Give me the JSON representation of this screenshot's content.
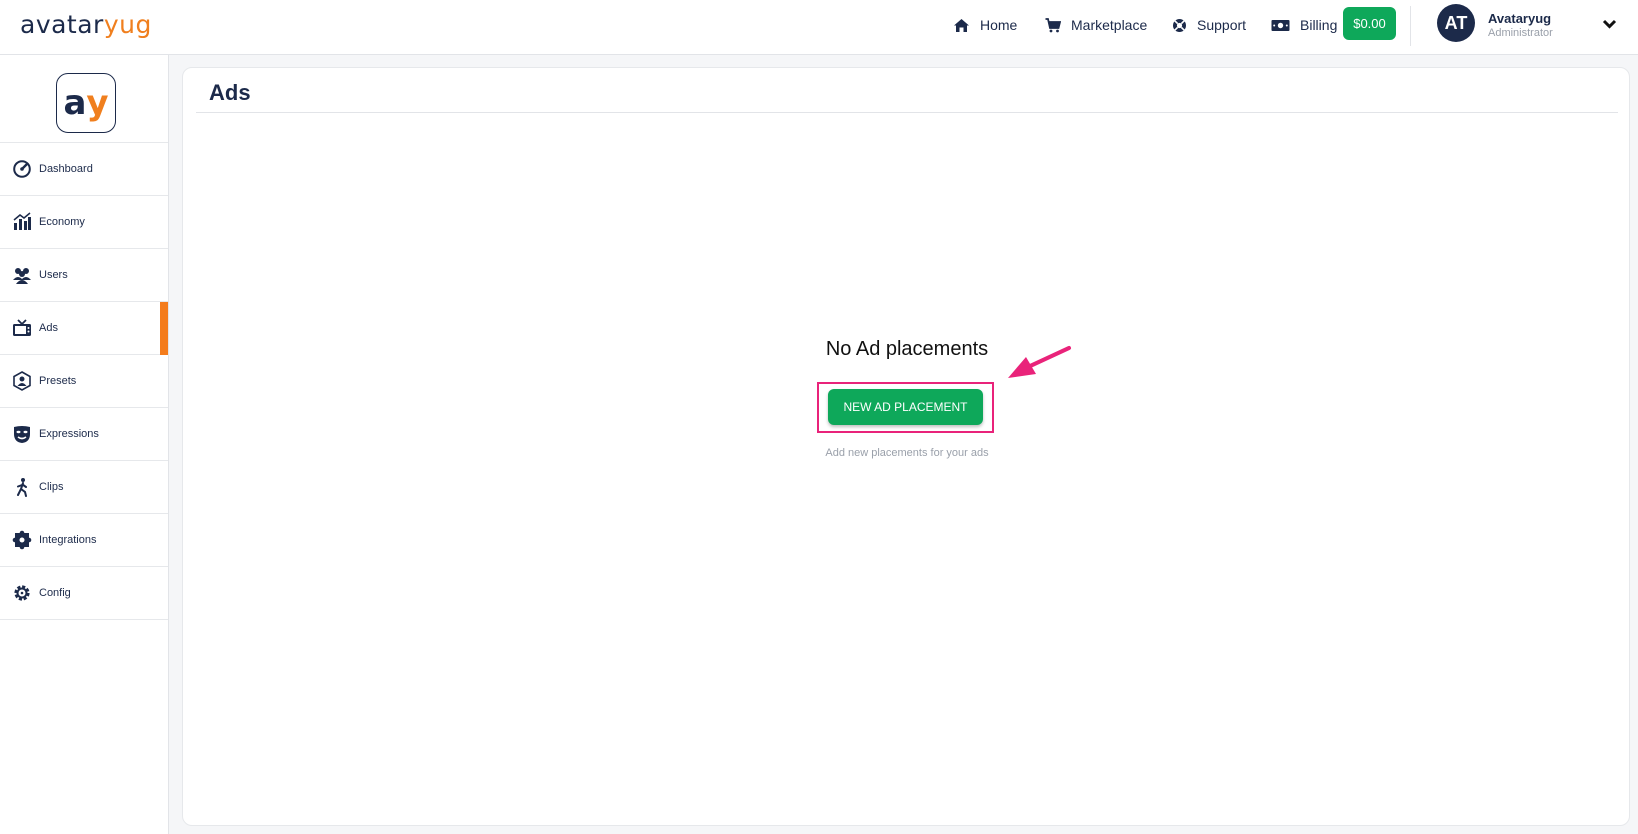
{
  "brand": {
    "part1": "avatar",
    "part2": "yug"
  },
  "nav": [
    {
      "label": "Home",
      "icon": "home-icon"
    },
    {
      "label": "Marketplace",
      "icon": "cart-icon"
    },
    {
      "label": "Support",
      "icon": "lifebuoy-icon"
    },
    {
      "label": "Billing",
      "icon": "money-icon"
    }
  ],
  "balance": "$0.00",
  "user": {
    "initials": "AT",
    "name": "Avataryug",
    "role": "Administrator"
  },
  "logo": {
    "letter1": "a",
    "letter2": "y"
  },
  "sidebar": {
    "items": [
      {
        "label": "Dashboard",
        "icon": "gauge-icon"
      },
      {
        "label": "Economy",
        "icon": "chart-icon"
      },
      {
        "label": "Users",
        "icon": "users-icon"
      },
      {
        "label": "Ads",
        "icon": "tv-icon",
        "active": true
      },
      {
        "label": "Presets",
        "icon": "presets-icon"
      },
      {
        "label": "Expressions",
        "icon": "mask-icon"
      },
      {
        "label": "Clips",
        "icon": "walking-icon"
      },
      {
        "label": "Integrations",
        "icon": "puzzle-icon"
      },
      {
        "label": "Config",
        "icon": "gear-icon"
      }
    ]
  },
  "main": {
    "title": "Ads",
    "empty_title": "No Ad placements",
    "button_label": "NEW AD PLACEMENT",
    "empty_subtitle": "Add new placements for your ads"
  },
  "colors": {
    "navy": "#1c2a4a",
    "orange": "#f47c1c",
    "green": "#0ea85a",
    "annotation": "#e9237a"
  }
}
